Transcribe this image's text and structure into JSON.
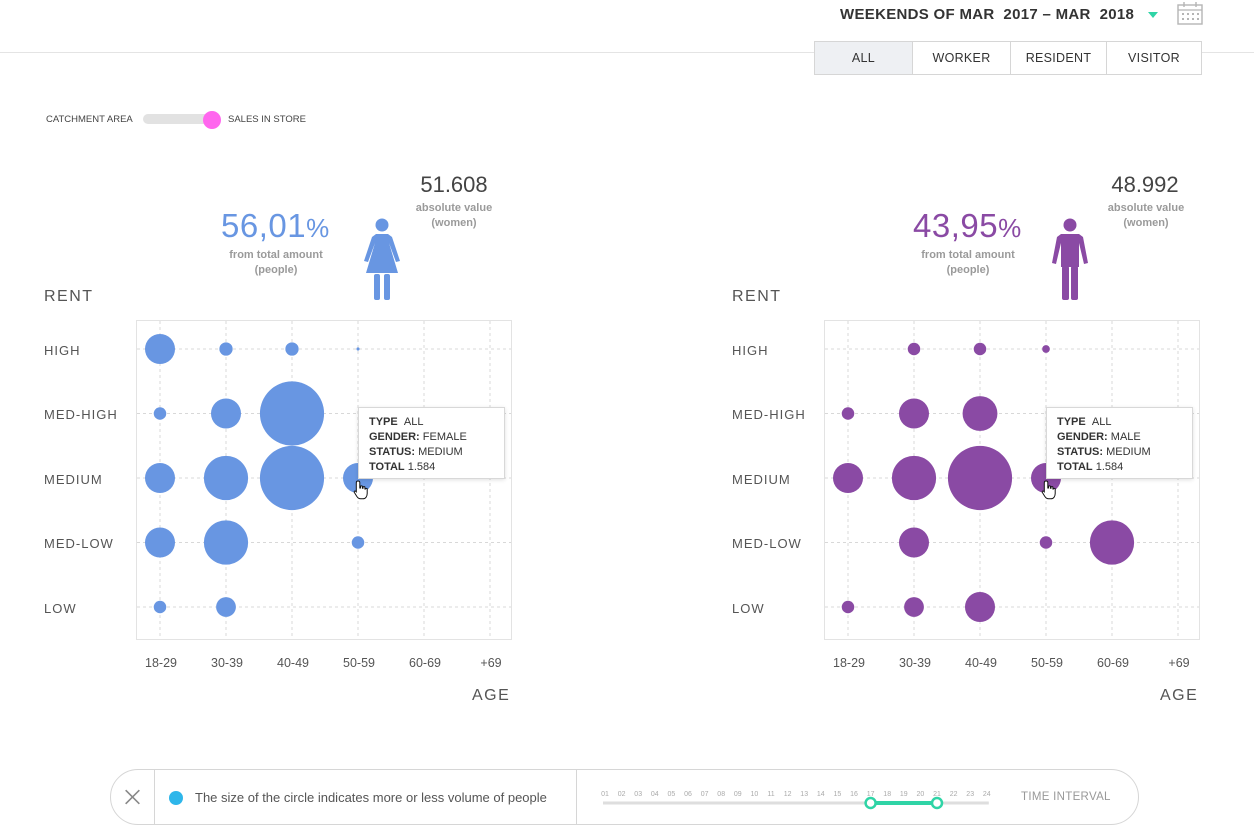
{
  "header": {
    "date_range": "WEEKENDS OF MAR  2017 – MAR  2018",
    "date_dropdown_icon": "chevron-down-icon",
    "calendar_icon": "calendar-icon"
  },
  "tabs": [
    {
      "label": "ALL",
      "active": true
    },
    {
      "label": "WORKER",
      "active": false
    },
    {
      "label": "RESIDENT",
      "active": false
    },
    {
      "label": "VISITOR",
      "active": false
    }
  ],
  "toggle": {
    "left_label": "CATCHMENT AREA",
    "right_label": "SALES IN STORE",
    "knob_color": "#ff66ee"
  },
  "female": {
    "percent_value": "56,01",
    "percent_unit": "%",
    "percent_label_1": "from total amount",
    "percent_label_2": "(people)",
    "absolute_value": "51.608",
    "absolute_label_1": "absolute value",
    "absolute_label_2": "(women)",
    "icon": "female-person-icon",
    "color": "#6896e2"
  },
  "male": {
    "percent_value": "43,95",
    "percent_unit": "%",
    "percent_label_1": "from total amount",
    "percent_label_2": "(people)",
    "absolute_value": "48.992",
    "absolute_label_1": "absolute value",
    "absolute_label_2": "(women)",
    "icon": "male-person-icon",
    "color": "#8a4aa4"
  },
  "chart_data": [
    {
      "type": "scatter",
      "subtype": "bubble",
      "ylabel": "RENT",
      "xlabel": "AGE",
      "x": [
        "18-29",
        "30-39",
        "40-49",
        "50-59",
        "60-69",
        "+69"
      ],
      "y": [
        "HIGH",
        "MED-HIGH",
        "MEDIUM",
        "MED-LOW",
        "LOW"
      ],
      "grid": true,
      "series": [
        {
          "color": "#6896e2",
          "points": [
            {
              "x": "18-29",
              "y": "HIGH",
              "size": 4.6
            },
            {
              "x": "30-39",
              "y": "HIGH",
              "size": 0.9
            },
            {
              "x": "40-49",
              "y": "HIGH",
              "size": 0.9
            },
            {
              "x": "50-59",
              "y": "HIGH",
              "size": 0.05
            },
            {
              "x": "18-29",
              "y": "MED-HIGH",
              "size": 0.8
            },
            {
              "x": "30-39",
              "y": "MED-HIGH",
              "size": 4.6
            },
            {
              "x": "40-49",
              "y": "MED-HIGH",
              "size": 21
            },
            {
              "x": "18-29",
              "y": "MEDIUM",
              "size": 4.6
            },
            {
              "x": "30-39",
              "y": "MEDIUM",
              "size": 10
            },
            {
              "x": "40-49",
              "y": "MEDIUM",
              "size": 21
            },
            {
              "x": "50-59",
              "y": "MEDIUM",
              "size": 4.6
            },
            {
              "x": "18-29",
              "y": "MED-LOW",
              "size": 4.6
            },
            {
              "x": "30-39",
              "y": "MED-LOW",
              "size": 10
            },
            {
              "x": "50-59",
              "y": "MED-LOW",
              "size": 0.8
            },
            {
              "x": "18-29",
              "y": "LOW",
              "size": 0.8
            },
            {
              "x": "30-39",
              "y": "LOW",
              "size": 2
            }
          ]
        }
      ],
      "tooltip": {
        "type_label": "TYPE",
        "type_value": "ALL",
        "gender_label": "GENDER:",
        "gender_value": "FEMALE",
        "status_label": "STATUS:",
        "status_value": "MEDIUM",
        "total_label": "TOTAL",
        "total_value": "1.584"
      }
    },
    {
      "type": "scatter",
      "subtype": "bubble",
      "ylabel": "RENT",
      "xlabel": "AGE",
      "x": [
        "18-29",
        "30-39",
        "40-49",
        "50-59",
        "60-69",
        "+69"
      ],
      "y": [
        "HIGH",
        "MED-HIGH",
        "MEDIUM",
        "MED-LOW",
        "LOW"
      ],
      "grid": true,
      "series": [
        {
          "color": "#8a4aa4",
          "points": [
            {
              "x": "30-39",
              "y": "HIGH",
              "size": 0.8
            },
            {
              "x": "40-49",
              "y": "HIGH",
              "size": 0.8
            },
            {
              "x": "50-59",
              "y": "HIGH",
              "size": 0.3
            },
            {
              "x": "18-29",
              "y": "MED-HIGH",
              "size": 0.8
            },
            {
              "x": "30-39",
              "y": "MED-HIGH",
              "size": 4.6
            },
            {
              "x": "40-49",
              "y": "MED-HIGH",
              "size": 6.2
            },
            {
              "x": "18-29",
              "y": "MEDIUM",
              "size": 4.6
            },
            {
              "x": "30-39",
              "y": "MEDIUM",
              "size": 10
            },
            {
              "x": "40-49",
              "y": "MEDIUM",
              "size": 21
            },
            {
              "x": "50-59",
              "y": "MEDIUM",
              "size": 4.6
            },
            {
              "x": "30-39",
              "y": "MED-LOW",
              "size": 4.6
            },
            {
              "x": "50-59",
              "y": "MED-LOW",
              "size": 0.8
            },
            {
              "x": "60-69",
              "y": "MED-LOW",
              "size": 10
            },
            {
              "x": "18-29",
              "y": "LOW",
              "size": 0.8
            },
            {
              "x": "30-39",
              "y": "LOW",
              "size": 2
            },
            {
              "x": "40-49",
              "y": "LOW",
              "size": 4.6
            }
          ]
        }
      ],
      "tooltip": {
        "type_label": "TYPE",
        "type_value": "ALL",
        "gender_label": "GENDER:",
        "gender_value": "MALE",
        "status_label": "STATUS:",
        "status_value": "MEDIUM",
        "total_label": "TOTAL",
        "total_value": "1.584"
      }
    }
  ],
  "footer": {
    "close_icon": "close-icon",
    "legend_dot_color": "#2eb6ea",
    "legend_text": "The size of the circle indicates more or less volume of people",
    "time_ticks": [
      "01",
      "02",
      "03",
      "04",
      "05",
      "06",
      "07",
      "08",
      "09",
      "10",
      "11",
      "12",
      "13",
      "14",
      "15",
      "16",
      "17",
      "18",
      "19",
      "20",
      "21",
      "22",
      "23",
      "24"
    ],
    "time_range_start": "17",
    "time_range_end": "21",
    "time_label": "TIME INTERVAL",
    "accent_color": "#2fd4a6"
  }
}
